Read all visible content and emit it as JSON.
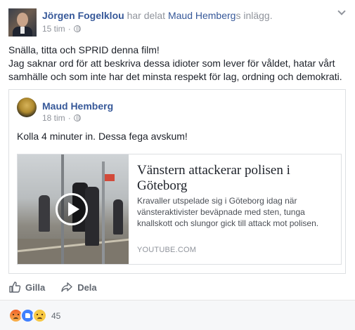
{
  "post": {
    "author": "Jörgen Fogelklou",
    "shared_prefix": "har delat",
    "shared_name": "Maud Hemberg",
    "shared_suffix": "s inlägg.",
    "time": "15 tim",
    "privacy_icon": "globe-icon",
    "text_line1": "Snälla, titta och SPRID denna film!",
    "text_line2": "Jag saknar ord för att beskriva dessa idioter som lever för våldet, hatar vårt samhälle och som inte har det minsta respekt för lag, ordning och demokrati."
  },
  "shared": {
    "author": "Maud Hemberg",
    "time": "18 tim",
    "privacy_icon": "globe-icon",
    "text": "Kolla 4 minuter in. Dessa fega avskum!"
  },
  "link": {
    "title": "Vänstern attackerar polisen i Göteborg",
    "description": "Kravaller utspelade sig i Göteborg idag när vänsteraktivister beväpnade med sten, tunga knallskott och slungor gick till attack mot polisen.",
    "source": "YOUTUBE.COM"
  },
  "actions": {
    "like_label": "Gilla",
    "share_label": "Dela"
  },
  "reactions": {
    "types": [
      "angry",
      "like",
      "sad"
    ],
    "count": "45"
  },
  "colors": {
    "link_blue": "#365899",
    "meta_gray": "#90949c",
    "like_blue": "#4080ff"
  }
}
